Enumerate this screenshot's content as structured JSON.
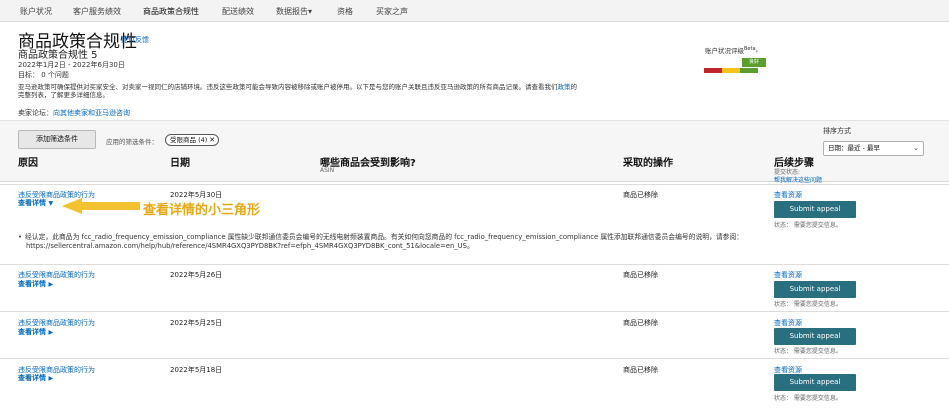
{
  "nav": {
    "items": [
      "账户状况",
      "客户服务绩效",
      "商品政策合规性",
      "配送绩效",
      "数据报告",
      "资格",
      "买家之声"
    ],
    "active_index": 2,
    "report_chevron": "▾"
  },
  "header": {
    "title": "商品政策合规性",
    "feedback": "提供反馈",
    "subtitle": "商品政策合规性 5",
    "date_range": "2022年1月2日 - 2022年6月30日",
    "target": "目标： 0 个问题",
    "description": "亚马逊政策可确保提供对买家安全、对卖家一视同仁的店铺环境。违反这些政策可能会导致内容被移除或账户被停用。以下是与您的账户关联且违反亚马逊政策的所有商品记录。请查看我们",
    "description_link": "政策",
    "description_tail": "的完整列表，了解更多详细信息。",
    "forum_label": "卖家论坛：",
    "forum_link": "向其他卖家和亚马逊咨询"
  },
  "health": {
    "label": "账户状况评级",
    "label_beta": "Beta",
    "badge": "良好"
  },
  "filters": {
    "add_button": "添加筛选条件",
    "applied_label": "应用的筛选条件：",
    "chip": "受限商品 (4)",
    "sort_label": "排序方式",
    "sort_value": "日期：最近 - 最早"
  },
  "columns": {
    "reason": "原因",
    "date": "日期",
    "impact": "哪些商品会受到影响?",
    "impact_sub": "ASIN",
    "action": "采取的操作",
    "next": "后续步骤",
    "next_sub": "提交状态:",
    "next_link": "帮我解决这些问题"
  },
  "rows": [
    {
      "reason": "违反受限商品政策的行为",
      "details": "查看详情",
      "date": "2022年5月30日",
      "action": "商品已移除",
      "next_link": "查看资源",
      "button": "Submit appeal",
      "status": "状态：  需要您提交信息。"
    },
    {
      "reason": "违反受限商品政策的行为",
      "details": "查看详情",
      "date": "2022年5月26日",
      "action": "商品已移除",
      "next_link": "查看资源",
      "button": "Submit appeal",
      "status": "状态：  需要您提交信息。"
    },
    {
      "reason": "违反受限商品政策的行为",
      "details": "查看详情",
      "date": "2022年5月25日",
      "action": "商品已移除",
      "next_link": "查看资源",
      "button": "Submit appeal",
      "status": "状态：  需要您提交信息。"
    },
    {
      "reason": "违反受限商品政策的行为",
      "details": "查看详情",
      "date": "2022年5月18日",
      "action": "商品已移除",
      "next_link": "查看资源",
      "button": "Submit appeal",
      "status": "状态：  需要您提交信息。"
    }
  ],
  "detail": {
    "line1": "经认定，此商品为 fcc_radio_frequency_emission_compliance 属性缺少联邦通信委员会编号的无线电射频装置商品。有关如何向您商品的 fcc_radio_frequency_emission_compliance 属性添加联邦通信委员会编号的说明，请参阅：",
    "line2": "https://sellercentral.amazon.com/help/hub/reference/4SMR4GXQ3PYD8BK?ref=efph_4SMR4GXQ3PYD8BK_cont_51&locale=en_US。"
  },
  "annotation": {
    "text": "查看详情的小三角形",
    "color": "#e8a815"
  },
  "icons": {
    "triangle_down": "▼",
    "triangle_right": "▶",
    "close": "✕",
    "chevron": "⌄"
  }
}
